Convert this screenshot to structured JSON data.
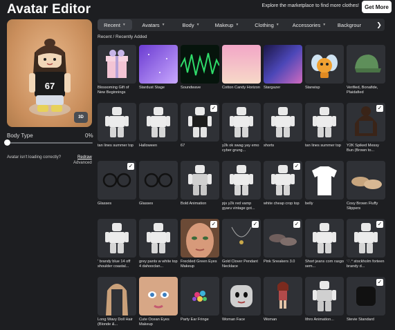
{
  "header": {
    "title": "Avatar Editor",
    "promo_text": "Explore the marketplace to find more clothes!",
    "get_more_label": "Get More"
  },
  "preview": {
    "badge_label": "3D",
    "shirt_number": "67"
  },
  "body_type": {
    "label": "Body Type",
    "value_text": "0%",
    "value": 0
  },
  "loading": {
    "question": "Avatar isn't loading correctly?",
    "redraw_label": "Redraw",
    "advanced_label": "Advanced"
  },
  "tabs": [
    {
      "label": "Recent",
      "active": true
    },
    {
      "label": "Avatars"
    },
    {
      "label": "Body"
    },
    {
      "label": "Makeup"
    },
    {
      "label": "Clothing"
    },
    {
      "label": "Accessories"
    },
    {
      "label": "Backgrour"
    }
  ],
  "breadcrumb": "Recent  /  Recently Added",
  "items": [
    {
      "name": "Blossoming Gift of New Beginnings",
      "art": "gift"
    },
    {
      "name": "Stardust Stage",
      "art": "stardust"
    },
    {
      "name": "Soundwave",
      "art": "soundwave"
    },
    {
      "name": "Cotton Candy Horizon",
      "art": "cottoncandy"
    },
    {
      "name": "Stargazer",
      "art": "stargazer"
    },
    {
      "name": "Starwisp",
      "art": "starwisp"
    },
    {
      "name": "Verified, Bonafide, Plaidafied",
      "art": "cap"
    },
    {
      "name": "tan lines summer top",
      "art": "fig"
    },
    {
      "name": "Halloween",
      "art": "fig"
    },
    {
      "name": "67",
      "art": "fig-dark",
      "checked": true
    },
    {
      "name": "y2k ok swag yay emo cyber grung...",
      "art": "fig"
    },
    {
      "name": "shorts",
      "art": "fig"
    },
    {
      "name": "tan lines summer top",
      "art": "fig"
    },
    {
      "name": "Y2K Spiked Messy Bun (Brown to...",
      "art": "hair",
      "checked": true
    },
    {
      "name": "Glasses",
      "art": "glasses",
      "checked": true
    },
    {
      "name": "Glasses",
      "art": "glasses"
    },
    {
      "name": "Bold Animation",
      "art": "fig-grey"
    },
    {
      "name": "pjs y2k red vamp gyaru vintage got...",
      "art": "fig"
    },
    {
      "name": "white cheap crop top",
      "art": "fig",
      "checked": true
    },
    {
      "name": "belly",
      "art": "shirt"
    },
    {
      "name": "Cosy Brown Fluffy Slippers",
      "art": "slippers"
    },
    {
      "name": "' brandy blue 14 off shoulder coastal...",
      "art": "fig"
    },
    {
      "name": "grey pants w white top 4 dahooclan...",
      "art": "fig"
    },
    {
      "name": "Freckled Green Eyes Makeup",
      "art": "face",
      "checked": true
    },
    {
      "name": "Gold Clover Pendant Necklace",
      "art": "necklace",
      "checked": true
    },
    {
      "name": "Pink Sneakers 3.0",
      "art": "sneakers",
      "checked": true
    },
    {
      "name": "Short jeans com rasgo sem...",
      "art": "fig"
    },
    {
      "name": "♡.° stockholm forteen brandy d...",
      "art": "fig",
      "checked": true
    },
    {
      "name": "Long Wavy Doll Hair (Blonde &...",
      "art": "longhair"
    },
    {
      "name": "Cute Ocean Eyes Makeup",
      "art": "oceanface"
    },
    {
      "name": "Party Ear Fringe",
      "art": "fringe"
    },
    {
      "name": "Woman Face",
      "art": "womanface"
    },
    {
      "name": "Woman",
      "art": "woman"
    },
    {
      "name": "Ithro Animation...",
      "art": "fig-grey"
    },
    {
      "name": "Stevie Standard",
      "art": "stevie",
      "checked": true
    }
  ]
}
